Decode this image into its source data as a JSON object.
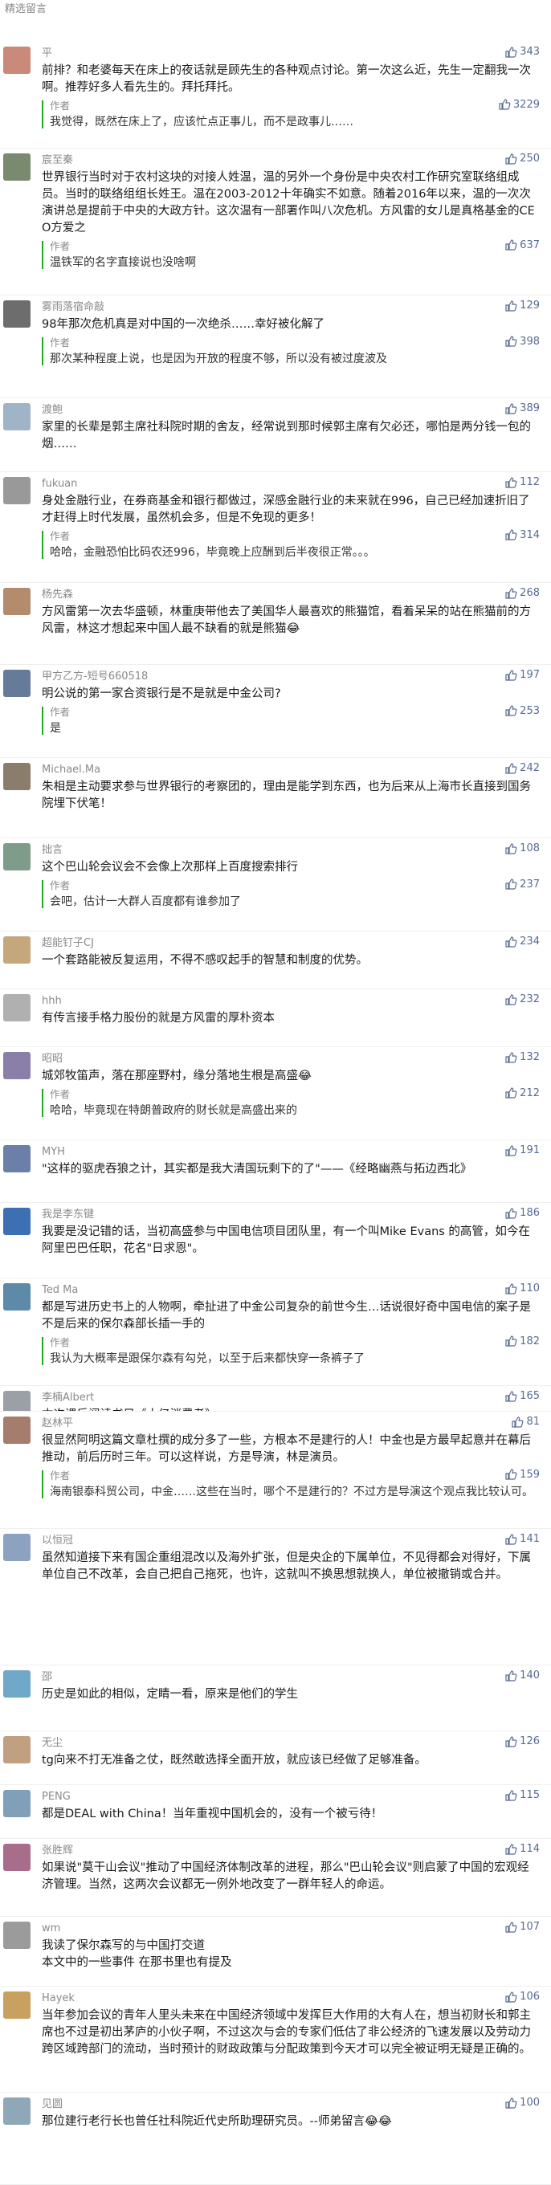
{
  "section_title": "精选留言",
  "author_label": "作者",
  "comments": [
    {
      "user": "平",
      "likes": "343",
      "text": "前排？和老婆每天在床上的夜话就是顾先生的各种观点讨论。第一次这么近，先生一定翻我一次啊。推荐好多人看先生的。拜托拜托。",
      "reply": {
        "likes": "3229",
        "text": "我觉得，既然在床上了，应该忙点正事儿，而不是政事儿……"
      }
    },
    {
      "user": "宸至秦",
      "likes": "250",
      "text": "世界银行当时对于农村这块的对接人姓温，温的另外一个身份是中央农村工作研究室联络组成员。当时的联络组组长姓王。温在2003-2012十年确实不如意。随着2016年以来，温的一次次演讲总是提前于中央的大政方针。这次温有一部署作叫八次危机。方风雷的女儿是真格基金的CEO方爱之",
      "reply": {
        "likes": "637",
        "text": "温铁军的名字直接说也没啥啊"
      }
    },
    {
      "user": "雾雨落宿命敲",
      "likes": "129",
      "text": "98年那次危机真是对中国的一次绝杀……幸好被化解了",
      "reply": {
        "likes": "398",
        "text": "那次某种程度上说，也是因为开放的程度不够，所以没有被过度波及"
      }
    },
    {
      "user": "渡鲍",
      "likes": "389",
      "text": "家里的长辈是郭主席社科院时期的舍友，经常说到那时候郭主席有欠必还，哪怕是两分钱一包的烟……",
      "reply": null
    },
    {
      "user": "fukuan",
      "likes": "112",
      "text": "身处金融行业，在券商基金和银行都做过，深感金融行业的未来就在996，自己已经加速折旧了才赶得上时代发展，虽然机会多，但是不免现的更多！",
      "reply": {
        "likes": "314",
        "text": "哈哈，金融恐怕比码农还996，毕竟晚上应酬到后半夜很正常。。。"
      }
    },
    {
      "user": "杨先森",
      "likes": "268",
      "text": "方风雷第一次去华盛顿，林重庚带他去了美国华人最喜欢的熊猫馆，看着呆呆的站在熊猫前的方风雷，林这才想起来中国人最不缺看的就是熊猫😂",
      "reply": null
    },
    {
      "user": "甲方乙方-短号660518",
      "likes": "197",
      "text": "明公说的第一家合资银行是不是就是中金公司?",
      "reply": {
        "likes": "253",
        "text": "是"
      }
    },
    {
      "user": "Michael.Ma",
      "likes": "242",
      "text": "朱相是主动要求参与世界银行的考察团的，理由是能学到东西，也为后来从上海市长直接到国务院埋下伏笔！",
      "reply": null
    },
    {
      "user": "拙言",
      "likes": "108",
      "text": "这个巴山轮会议会不会像上次那样上百度搜索排行",
      "reply": {
        "likes": "237",
        "text": "会吧，估计一大群人百度都有谁参加了"
      }
    },
    {
      "user": "超能钉子CJ",
      "likes": "234",
      "text": "一个套路能被反复运用，不得不感叹起手的智慧和制度的优势。",
      "reply": null
    },
    {
      "user": "hhh",
      "likes": "232",
      "text": "有传言接手格力股份的就是方风雷的厚朴资本",
      "reply": null
    },
    {
      "user": "昭昭",
      "likes": "132",
      "text": "城郊牧笛声，落在那座野村，缘分落地生根是高盛😂",
      "reply": {
        "likes": "212",
        "text": "哈哈，毕竟现在特朗普政府的财长就是高盛出来的"
      }
    },
    {
      "user": "MYH",
      "likes": "191",
      "text": "\"这样的驱虎吞狼之计，其实都是我大清国玩剩下的了\"——《经略幽燕与拓边西北》",
      "reply": null
    },
    {
      "user": "我是李东键",
      "likes": "186",
      "text": "我要是没记错的话，当初高盛参与中国电信项目团队里，有一个叫Mike Evans 的高管，如今在阿里巴巴任职，花名\"日求恩\"。",
      "reply": null
    },
    {
      "user": "Ted Ma",
      "likes": "110",
      "text": "都是写进历史书上的人物啊，牵扯进了中金公司复杂的前世今生…话说很好奇中国电信的案子是不是后来的保尔森部长插一手的",
      "reply": {
        "likes": "182",
        "text": "我认为大概率是跟保尔森有勾兑，以至于后来都快穿一条裤子了"
      }
    },
    {
      "user": "李楠Albert",
      "likes": "165",
      "text": "本次课后阅读书目《十亿消费者》",
      "reply": null
    },
    {
      "user": "赵林平",
      "likes": "81",
      "text": "很显然阿明这篇文章杜撰的成分多了一些，方根本不是建行的人！中金也是方最早起意并在幕后推动，前后历时三年。可以这样说，方是导演，林是演员。",
      "reply": {
        "likes": "159",
        "text": "海南银泰科贸公司，中金……这些在当时，哪个不是建行的？不过方是导演这个观点我比较认可。"
      }
    },
    {
      "user": "以恒冠",
      "likes": "141",
      "text": "虽然知道接下来有国企重组混改以及海外扩张，但是央企的下属单位，不见得都会对得好，下属单位自己不改革，会自己把自己拖死，也许，这就叫不换思想就换人，单位被撤销或合并。",
      "reply": null
    },
    {
      "user": "邵",
      "likes": "140",
      "text": "历史是如此的相似，定睛一看，原来是他们的学生",
      "reply": null
    },
    {
      "user": "无尘",
      "likes": "126",
      "text": "tg向来不打无准备之仗，既然敢选择全面开放，就应该已经做了足够准备。",
      "reply": null
    },
    {
      "user": "PENG",
      "likes": "115",
      "text": "都是DEAL with China！当年重视中国机会的，没有一个被亏待！",
      "reply": null
    },
    {
      "user": "张胜辉",
      "likes": "114",
      "text": "如果说\"莫干山会议\"推动了中国经济体制改革的进程，那么\"巴山轮会议\"则启蒙了中国的宏观经济管理。当然，这两次会议都无一例外地改变了一群年轻人的命运。",
      "reply": null
    },
    {
      "user": "wm",
      "likes": "107",
      "text": "我读了保尔森写的与中国打交道\n本文中的一些事件 在那书里也有提及",
      "reply": null
    },
    {
      "user": "Hayek",
      "likes": "106",
      "text": "当年参加会议的青年人里头未来在中国经济领域中发挥巨大作用的大有人在，想当初财长和郭主席也不过是初出茅庐的小伙子啊，不过这次与会的专家们低估了非公经济的飞速发展以及劳动力跨区域跨部门的流动，当时预计的财政政策与分配政策到今天才可以完全被证明无疑是正确的。",
      "reply": null
    },
    {
      "user": "见圆",
      "likes": "100",
      "text": "那位建行老行长也曾任社科院近代史所助理研究员。--师弟留言😂😂",
      "reply": null
    }
  ]
}
